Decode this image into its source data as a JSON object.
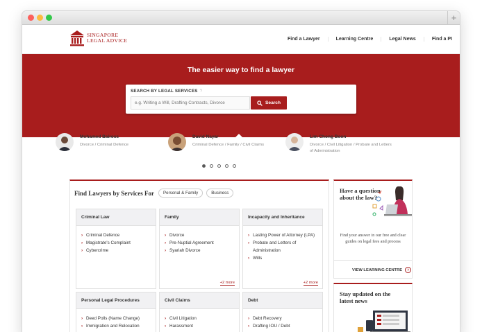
{
  "browser": {
    "new_tab_label": "+"
  },
  "logo": {
    "line1": "SINGAPORE",
    "line2": "LEGAL ADVICE"
  },
  "nav": [
    "Find a Lawyer",
    "Learning Centre",
    "Legal News",
    "Find a PI"
  ],
  "hero": {
    "title": "The easier way to find a lawyer",
    "search_label": "SEARCH BY LEGAL SERVICES",
    "search_info": "?",
    "search_placeholder": "e.g. Writing a Will, Drafting Contracts, Divorce",
    "search_button": "Search"
  },
  "lawyers": [
    {
      "name": "Mohamed Baiross",
      "tags": "Divorce / Criminal Defence"
    },
    {
      "name": "David Nayar",
      "tags": "Criminal Defence / Family / Civil Claims"
    },
    {
      "name": "Lim Chong Boon",
      "tags": "Divorce / Civil Litigation / Probate and Letters of Administration"
    }
  ],
  "carousel": {
    "pages": 5,
    "active": 0
  },
  "services": {
    "title": "Find Lawyers by Services For",
    "tabs": [
      "Personal & Family",
      "Business"
    ],
    "cards": [
      {
        "title": "Criminal Law",
        "items": [
          "Criminal Defence",
          "Magistrate's Complaint",
          "Cybercrime"
        ],
        "more": ""
      },
      {
        "title": "Family",
        "items": [
          "Divorce",
          "Pre-Nuptial Agreement",
          "Syariah Divorce"
        ],
        "more": "+2 more"
      },
      {
        "title": "Incapacity and Inheritance",
        "items": [
          "Lasting Power of Attorney (LPA)",
          "Probate and Letters of Administration",
          "Wills"
        ],
        "more": "+2 more"
      },
      {
        "title": "Personal Legal Procedures",
        "items": [
          "Deed Polls (Name Change)",
          "Immigration and Relocation"
        ],
        "more": ""
      },
      {
        "title": "Civil Claims",
        "items": [
          "Civil Litigation",
          "Harassment"
        ],
        "more": ""
      },
      {
        "title": "Debt",
        "items": [
          "Debt Recovery",
          "Drafting IOU / Debt"
        ],
        "more": ""
      }
    ]
  },
  "sidebar": {
    "question": {
      "title": "Have a question about the law?",
      "text": "Find your answer in our free and clear guides on legal fees and process",
      "link": "VIEW LEARNING CENTRE"
    },
    "news": {
      "title": "Stay updated on the latest news"
    }
  },
  "colors": {
    "brand_red": "#a81d1d"
  }
}
